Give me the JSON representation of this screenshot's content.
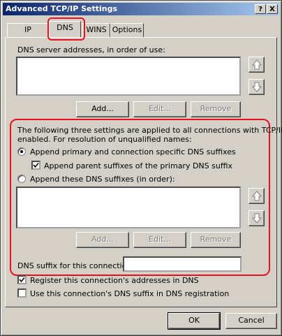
{
  "window": {
    "title": "Advanced TCP/IP Settings"
  },
  "titlebar": {
    "help_label": "?",
    "close_label": "X"
  },
  "tabs": [
    {
      "label": "IP Settings"
    },
    {
      "label": "DNS"
    },
    {
      "label": "WINS"
    },
    {
      "label": "Options"
    }
  ],
  "dns_servers": {
    "label": "DNS server addresses, in order of use:",
    "add_label": "Add...",
    "edit_label": "Edit...",
    "remove_label": "Remove"
  },
  "settings": {
    "intro_line1": "The following three settings are applied to all connections with TCP/IP",
    "intro_line2": "enabled. For resolution of unqualified names:",
    "option_primary": "Append primary and connection specific DNS suffixes",
    "option_parent": "Append parent suffixes of the primary DNS suffix",
    "option_these": "Append these DNS suffixes (in order):",
    "add_label": "Add...",
    "edit_label": "Edit...",
    "remove_label": "Remove",
    "suffix_label": "DNS suffix for this connection:"
  },
  "register": {
    "register_addresses": "Register this connection's addresses in DNS",
    "use_suffix": "Use this connection's DNS suffix in DNS registration"
  },
  "footer": {
    "ok_label": "OK",
    "cancel_label": "Cancel"
  },
  "colors": {
    "title_start": "#0a246a",
    "title_end": "#a6caf0",
    "highlight": "#e8101a",
    "face": "#d4d0c8"
  }
}
